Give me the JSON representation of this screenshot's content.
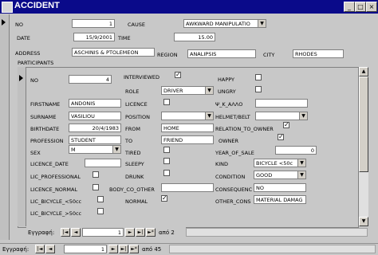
{
  "window": {
    "title": "ACCIDENT",
    "min": "_",
    "max": "□",
    "close": "×"
  },
  "main": {
    "no_label": "NO",
    "no_value": "1",
    "cause_label": "CAUSE",
    "cause_value": "AWKWARD MANIPULATIO",
    "date_label": "DATE",
    "date_value": "15/9/2001",
    "time_label": "TIME",
    "time_value": "15.00",
    "address_label": "ADDRESS",
    "address_value": "ASCHINIS & PTOLEMEON",
    "region_label": "REGION",
    "region_value": "ANALIPSIS",
    "city_label": "CITY",
    "city_value": "RHODES",
    "participants_label": "PARTICIPANTS"
  },
  "participant": {
    "no_label": "NO",
    "no_value": "4",
    "interviewed_label": "INTERVIEWED",
    "interviewed": true,
    "happy_label": "HAPPY",
    "happy": false,
    "role_label": "ROLE",
    "role_value": "DRIVER",
    "ungry_label": "UNGRY",
    "ungry": false,
    "firstname_label": "FIRSTNAME",
    "firstname_value": "ANDONIS",
    "licence_label": "LICENCE",
    "licence": false,
    "psi_label": "Ψ_Κ_ΑΛΛΟ",
    "psi_value": "",
    "surname_label": "SURNAME",
    "surname_value": "VASILIOU",
    "position_label": "POSITION",
    "position_value": "",
    "helmet_label": "HELMET/BELT",
    "helmet_value": "",
    "birthdate_label": "BIRTHDATE",
    "birthdate_value": "20/4/1983",
    "from_label": "FROM",
    "from_value": "HOME",
    "relation_label": "RELATION_TO_OWNER",
    "relation": true,
    "profession_label": "PROFESSION",
    "profession_value": "STUDENT",
    "to_label": "TO",
    "to_value": "FRIEND",
    "owner_label": "OWNER",
    "owner": true,
    "sex_label": "SEX",
    "sex_value": "M",
    "tired_label": "TIRED",
    "tired": false,
    "year_of_sale_label": "YEAR_OF_SALE",
    "year_of_sale_value": "0",
    "licence_date_label": "LICENCE_DATE",
    "licence_date_value": "",
    "sleepy_label": "SLEEPY",
    "sleepy": false,
    "kind_label": "KIND",
    "kind_value": "BICYCLE <50c",
    "lic_professional_label": "LIC_PROFESSIONAL",
    "lic_professional": false,
    "drunk_label": "DRUNK",
    "drunk": false,
    "condition_label": "CONDITION",
    "condition_value": "GOOD",
    "licence_normal_label": "LICENCE_NORMAL",
    "licence_normal": false,
    "body_co_other_label": "BODY_CO_OTHER",
    "body_co_other_value": "",
    "consequence_label": "CONSEQUENC",
    "consequence_value": "NO",
    "lic_bicycle_50_label": "LIC_BICYCLE_<50cc",
    "lic_bicycle_50": false,
    "normal_label": "NORMAL",
    "normal": true,
    "other_cons_label": "OTHER_CONS",
    "other_cons_value": "MATERIAL DAMAG",
    "lic_bicycle_50_2_label": "LIC_BICYCLE_>50cc",
    "lic_bicycle_50_2": false
  },
  "sub_nav": {
    "label": "Εγγραφή:",
    "current": "1",
    "of_text": "από 2"
  },
  "main_nav": {
    "label": "Εγγραφή:",
    "current": "1",
    "of_text": "από 45"
  },
  "nav_glyphs": {
    "first": "|◄",
    "prev": "◄",
    "next": "►",
    "last": "►|",
    "new": "►*"
  }
}
